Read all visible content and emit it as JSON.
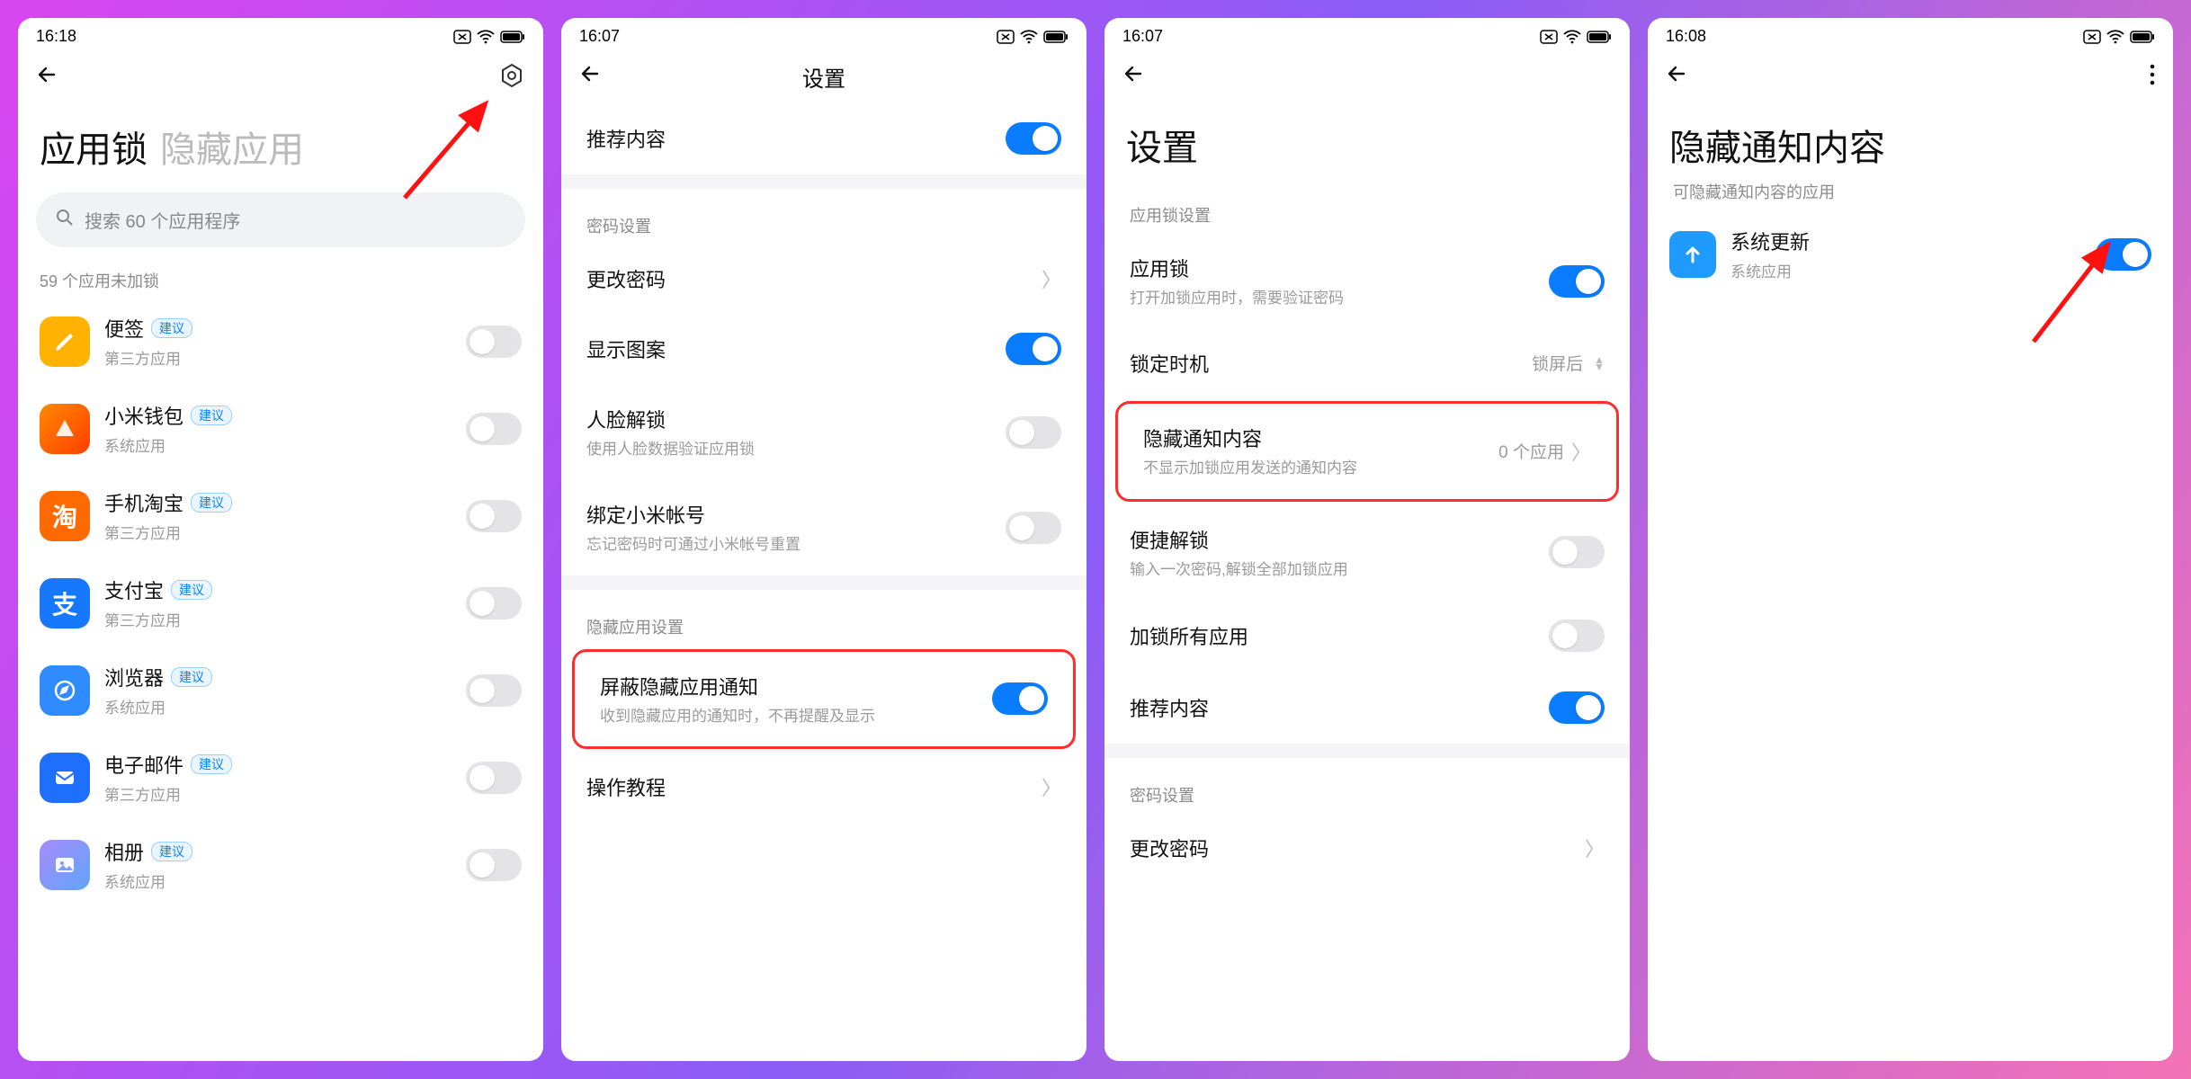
{
  "status": {
    "t1": "16:18",
    "t2": "16:07",
    "t3": "16:07",
    "t4": "16:08"
  },
  "screen1": {
    "tab_active": "应用锁",
    "tab_inactive": "隐藏应用",
    "search_placeholder": "搜索 60 个应用程序",
    "unlocked_hint": "59 个应用未加锁",
    "badge": "建议",
    "cat_third": "第三方应用",
    "cat_sys": "系统应用",
    "apps": {
      "a0": "便签",
      "a1": "小米钱包",
      "a2": "手机淘宝",
      "a3": "支付宝",
      "a4": "浏览器",
      "a5": "电子邮件",
      "a6": "相册"
    }
  },
  "screen2": {
    "title": "设置",
    "sec_password": "密码设置",
    "sec_hidden": "隐藏应用设置",
    "i_recommend": "推荐内容",
    "i_change_pw": "更改密码",
    "i_show_pattern": "显示图案",
    "i_face": "人脸解锁",
    "i_face_sub": "使用人脸数据验证应用锁",
    "i_bind": "绑定小米帐号",
    "i_bind_sub": "忘记密码时可通过小米帐号重置",
    "i_block": "屏蔽隐藏应用通知",
    "i_block_sub": "收到隐藏应用的通知时，不再提醒及显示",
    "i_tutorial": "操作教程"
  },
  "screen3": {
    "title": "设置",
    "sec_applock": "应用锁设置",
    "sec_password": "密码设置",
    "i_applock": "应用锁",
    "i_applock_sub": "打开加锁应用时，需要验证密码",
    "i_locktime": "锁定时机",
    "i_locktime_val": "锁屏后",
    "i_hide": "隐藏通知内容",
    "i_hide_sub": "不显示加锁应用发送的通知内容",
    "i_hide_val": "0 个应用",
    "i_quick": "便捷解锁",
    "i_quick_sub": "输入一次密码,解锁全部加锁应用",
    "i_lockall": "加锁所有应用",
    "i_recommend": "推荐内容",
    "i_change_pw": "更改密码"
  },
  "screen4": {
    "title": "隐藏通知内容",
    "subtitle": "可隐藏通知内容的应用",
    "app_name": "系统更新",
    "app_cat": "系统应用"
  }
}
